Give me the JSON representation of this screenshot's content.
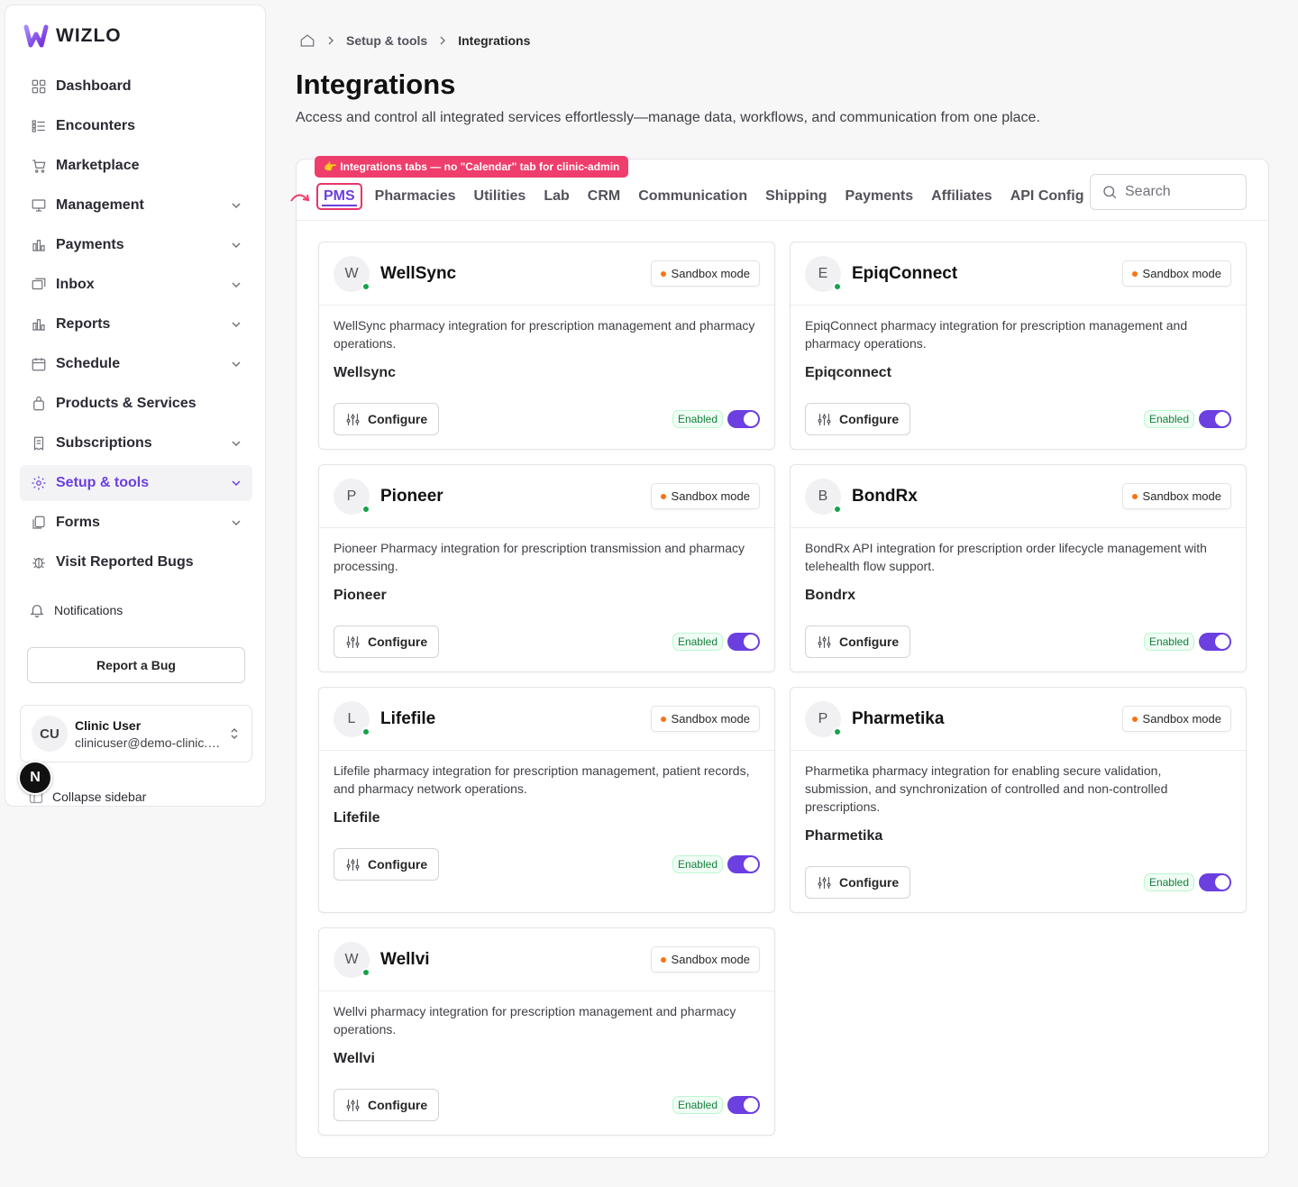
{
  "brand": {
    "name": "WIZLO"
  },
  "sidebar": {
    "items": [
      {
        "label": "Dashboard",
        "icon": "grid-icon",
        "chevron": false
      },
      {
        "label": "Encounters",
        "icon": "list-icon",
        "chevron": false
      },
      {
        "label": "Marketplace",
        "icon": "cart-icon",
        "chevron": false
      },
      {
        "label": "Management",
        "icon": "monitor-icon",
        "chevron": true
      },
      {
        "label": "Payments",
        "icon": "bar-chart-icon",
        "chevron": true
      },
      {
        "label": "Inbox",
        "icon": "inbox-icon",
        "chevron": true
      },
      {
        "label": "Reports",
        "icon": "bar-chart-icon",
        "chevron": true
      },
      {
        "label": "Schedule",
        "icon": "calendar-icon",
        "chevron": true
      },
      {
        "label": "Products & Services",
        "icon": "bag-icon",
        "chevron": false
      },
      {
        "label": "Subscriptions",
        "icon": "receipt-icon",
        "chevron": true
      },
      {
        "label": "Setup & tools",
        "icon": "gear-icon",
        "chevron": true,
        "active": true
      },
      {
        "label": "Forms",
        "icon": "files-icon",
        "chevron": true
      },
      {
        "label": "Visit Reported Bugs",
        "icon": "bug-icon",
        "chevron": false
      }
    ],
    "notifications_label": "Notifications",
    "report_bug_label": "Report a Bug",
    "user": {
      "initials": "CU",
      "name": "Clinic User",
      "email": "clinicuser@demo-clinic.c..."
    },
    "n_badge": "N",
    "collapse_label": "Collapse sidebar"
  },
  "breadcrumb": {
    "items": [
      "Setup & tools",
      "Integrations"
    ]
  },
  "page": {
    "title": "Integrations",
    "subtitle": "Access and control all integrated services effortlessly—manage data, workflows, and communication from one place."
  },
  "annotation": {
    "text": "👉 Integrations tabs — no \"Calendar\" tab for clinic-admin"
  },
  "tabs": [
    "PMS",
    "Pharmacies",
    "Utilities",
    "Lab",
    "CRM",
    "Communication",
    "Shipping",
    "Payments",
    "Affiliates",
    "API Config"
  ],
  "search": {
    "placeholder": "Search"
  },
  "cards": [
    {
      "initial": "W",
      "title": "WellSync",
      "badge": "Sandbox mode",
      "desc": "WellSync pharmacy integration for prescription management and pharmacy operations.",
      "name": "Wellsync",
      "configure": "Configure",
      "status": "Enabled"
    },
    {
      "initial": "E",
      "title": "EpiqConnect",
      "badge": "Sandbox mode",
      "desc": "EpiqConnect pharmacy integration for prescription management and pharmacy operations.",
      "name": "Epiqconnect",
      "configure": "Configure",
      "status": "Enabled"
    },
    {
      "initial": "P",
      "title": "Pioneer",
      "badge": "Sandbox mode",
      "desc": "Pioneer Pharmacy integration for prescription transmission and pharmacy processing.",
      "name": "Pioneer",
      "configure": "Configure",
      "status": "Enabled"
    },
    {
      "initial": "B",
      "title": "BondRx",
      "badge": "Sandbox mode",
      "desc": "BondRx API integration for prescription order lifecycle management with telehealth flow support.",
      "name": "Bondrx",
      "configure": "Configure",
      "status": "Enabled"
    },
    {
      "initial": "L",
      "title": "Lifefile",
      "badge": "Sandbox mode",
      "desc": "Lifefile pharmacy integration for prescription management, patient records, and pharmacy network operations.",
      "name": "Lifefile",
      "configure": "Configure",
      "status": "Enabled"
    },
    {
      "initial": "P",
      "title": "Pharmetika",
      "badge": "Sandbox mode",
      "desc": "Pharmetika pharmacy integration for enabling secure validation, submission, and synchronization of controlled and non-controlled prescriptions.",
      "name": "Pharmetika",
      "configure": "Configure",
      "status": "Enabled"
    },
    {
      "initial": "W",
      "title": "Wellvi",
      "badge": "Sandbox mode",
      "desc": "Wellvi pharmacy integration for prescription management and pharmacy operations.",
      "name": "Wellvi",
      "configure": "Configure",
      "status": "Enabled"
    }
  ],
  "colors": {
    "accent": "#6b3fe0",
    "annotation": "#ef3d6c",
    "status_dot": "#16a34a",
    "sandbox_dot": "#f97316"
  }
}
